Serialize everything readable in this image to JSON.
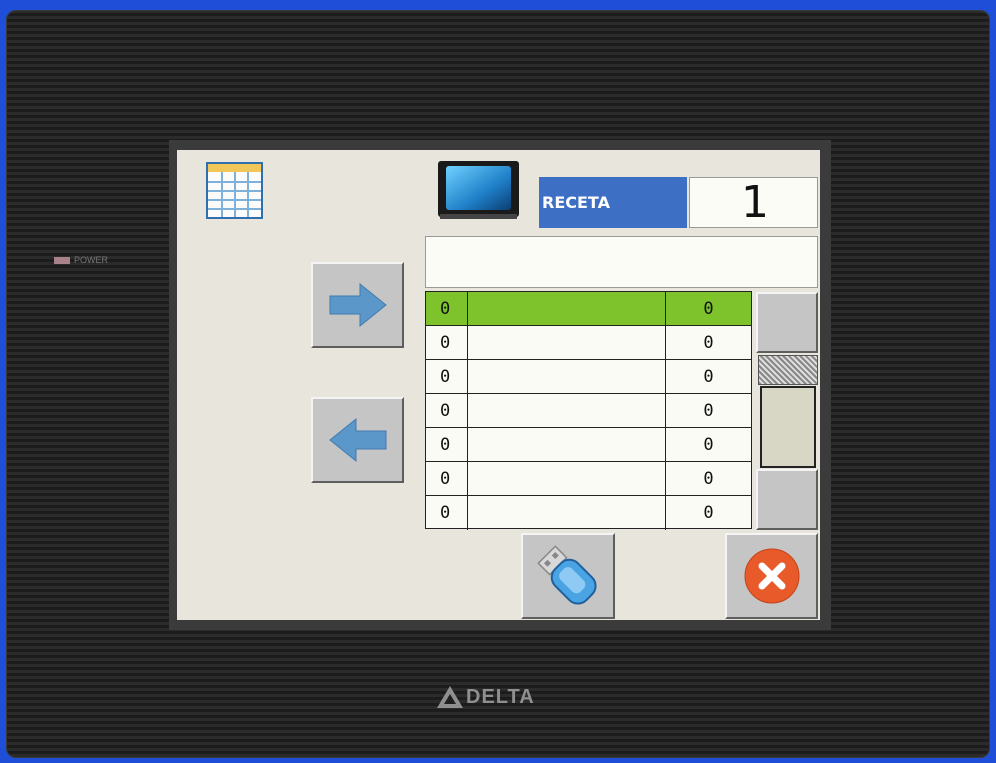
{
  "device": {
    "power_label": "POWER",
    "brand_logo": "DELTA"
  },
  "screen": {
    "recipe_label": "RECETA",
    "recipe_number": "1",
    "recipe_name": "",
    "icons": {
      "recipe_table": "recipe-table-icon",
      "monitor": "monitor-icon",
      "next": "arrow-right-icon",
      "prev": "arrow-left-icon",
      "usb": "usb-drive-icon",
      "close": "close-icon"
    },
    "table": {
      "rows": [
        {
          "index": "0",
          "name": "",
          "value": "0",
          "selected": true
        },
        {
          "index": "0",
          "name": "",
          "value": "0",
          "selected": false
        },
        {
          "index": "0",
          "name": "",
          "value": "0",
          "selected": false
        },
        {
          "index": "0",
          "name": "",
          "value": "0",
          "selected": false
        },
        {
          "index": "0",
          "name": "",
          "value": "0",
          "selected": false
        },
        {
          "index": "0",
          "name": "",
          "value": "0",
          "selected": false
        },
        {
          "index": "0",
          "name": "",
          "value": "0",
          "selected": false
        }
      ]
    }
  },
  "colors": {
    "selected_row": "#7ec32b",
    "recipe_label_bg": "#3d6fc4",
    "screen_bg": "#e8e6dc",
    "close_button": "#e85a2a",
    "arrow": "#5c97c9"
  }
}
